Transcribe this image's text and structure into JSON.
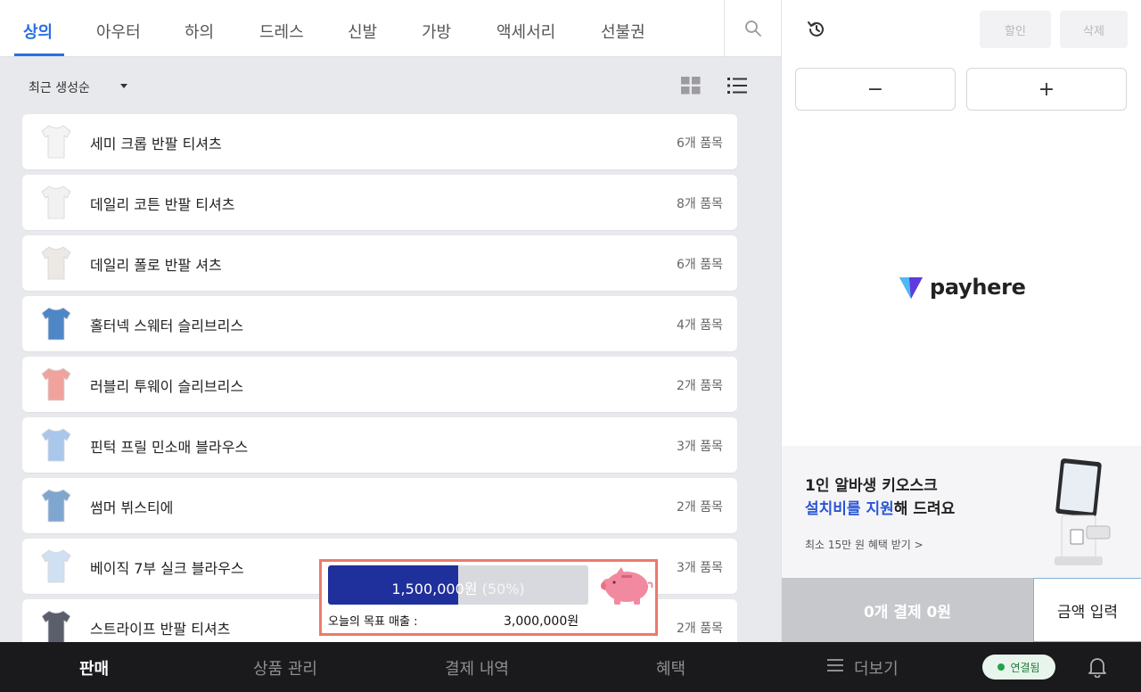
{
  "categories": [
    "상의",
    "아우터",
    "하의",
    "드레스",
    "신발",
    "가방",
    "액세서리",
    "선불권"
  ],
  "sort": {
    "label": "최근 생성순"
  },
  "products": [
    {
      "name": "세미 크롭 반팔 티셔츠",
      "count": "6개 품목",
      "thumb_color": "#f4f4f4"
    },
    {
      "name": "데일리 코튼 반팔 티셔츠",
      "count": "8개 품목",
      "thumb_color": "#f1f1f1"
    },
    {
      "name": "데일리 폴로 반팔 셔츠",
      "count": "6개 품목",
      "thumb_color": "#ece8e3"
    },
    {
      "name": "홀터넥 스웨터 슬리브리스",
      "count": "4개 품목",
      "thumb_color": "#4f86c6"
    },
    {
      "name": "러블리 투웨이 슬리브리스",
      "count": "2개 품목",
      "thumb_color": "#f0a39c"
    },
    {
      "name": "핀턱 프릴 민소매 블라우스",
      "count": "3개 품목",
      "thumb_color": "#a9c7ea"
    },
    {
      "name": "썸머 뷔스티에",
      "count": "2개 품목",
      "thumb_color": "#7ea6cf"
    },
    {
      "name": "베이직 7부 실크 블라우스",
      "count": "3개 품목",
      "thumb_color": "#cfe0f2"
    },
    {
      "name": "스트라이프 반팔 티셔츠",
      "count": "2개 품목",
      "thumb_color": "#5a5f6b"
    }
  ],
  "goal": {
    "current": "1,500,000원",
    "percent_text": "(50%)",
    "progress": 0.5,
    "label": "오늘의 목표 매출 :",
    "target": "3,000,000원"
  },
  "right": {
    "discount_label": "할인",
    "delete_label": "삭제",
    "minus_label": "−",
    "plus_label": "+",
    "brand": "payhere",
    "promo_line1": "1인 알바생 키오스크",
    "promo_highlight": "설치비를 지원",
    "promo_rest": "해 드려요",
    "promo_sub": "최소 15만 원 혜택 받기 >",
    "pay_label": "0개 결제  0원",
    "amount_label": "금액 입력"
  },
  "nav": {
    "items": [
      "판매",
      "상품 관리",
      "결제 내역",
      "혜택",
      "더보기"
    ],
    "status": "연결됨"
  },
  "colors": {
    "accent": "#2a6fe0",
    "goal_fill": "#1f2f9c",
    "goal_border": "#ec7a6b",
    "nav_bg": "#1a1a1c"
  }
}
